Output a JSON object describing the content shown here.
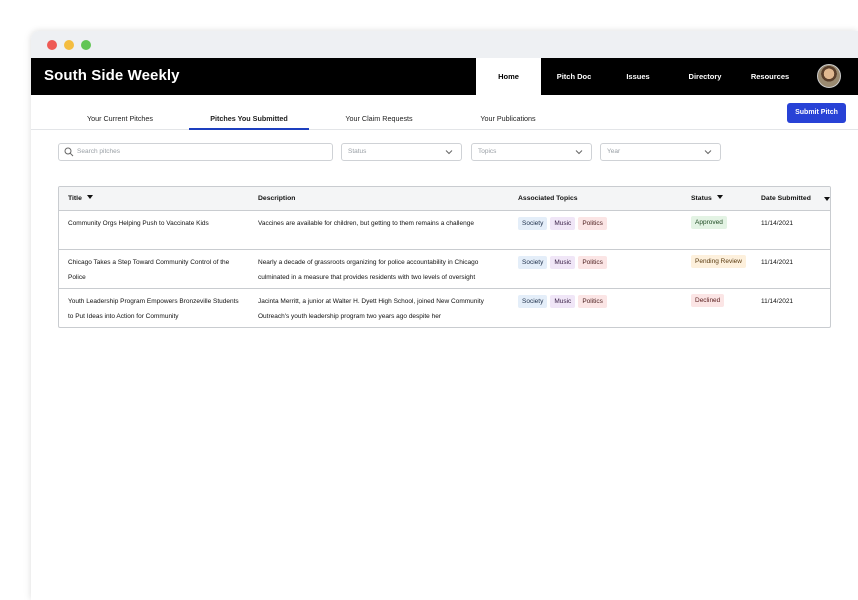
{
  "app": {
    "brand": "South Side Weekly",
    "nav": [
      "Home",
      "Pitch Doc",
      "Issues",
      "Directory",
      "Resources"
    ],
    "active_nav": "Home"
  },
  "tabs": [
    "Your Current Pitches",
    "Pitches You Submitted",
    "Your Claim Requests",
    "Your Publications"
  ],
  "active_tab": "Pitches You Submitted",
  "submit_button": "Submit Pitch",
  "filters": {
    "search_placeholder": "Search pitches",
    "status": "Status",
    "topics": "Topics",
    "year": "Year"
  },
  "table": {
    "headers": {
      "title": "Title",
      "description": "Description",
      "topics": "Associated Topics",
      "status": "Status",
      "date": "Date Submitted"
    },
    "rows": [
      {
        "title": "Community Orgs Helping Push to Vaccinate Kids",
        "description": "Vaccines are available for children, but getting to them remains a challenge",
        "topics": [
          "Society",
          "Music",
          "Politics"
        ],
        "status": "Approved",
        "date": "11/14/2021"
      },
      {
        "title": "Chicago Takes a Step Toward Community Control of the Police",
        "description": "Nearly a decade of grassroots organizing for police accountability in Chicago culminated in a measure that provides residents with two levels of oversight",
        "topics": [
          "Society",
          "Music",
          "Politics"
        ],
        "status": "Pending Review",
        "date": "11/14/2021"
      },
      {
        "title": "Youth Leadership Program Empowers Bronzeville Students to Put Ideas into Action for Community",
        "description": "Jacinta Merritt, a junior at Walter H. Dyett High School, joined New Community Outreach's youth leadership program two years ago despite her",
        "topics": [
          "Society",
          "Music",
          "Politics"
        ],
        "status": "Declined",
        "date": "11/14/2021"
      }
    ]
  },
  "colors": {
    "accent": "#2842d6",
    "tab_underline": "#1d3fbf",
    "topbar": "#000000"
  }
}
